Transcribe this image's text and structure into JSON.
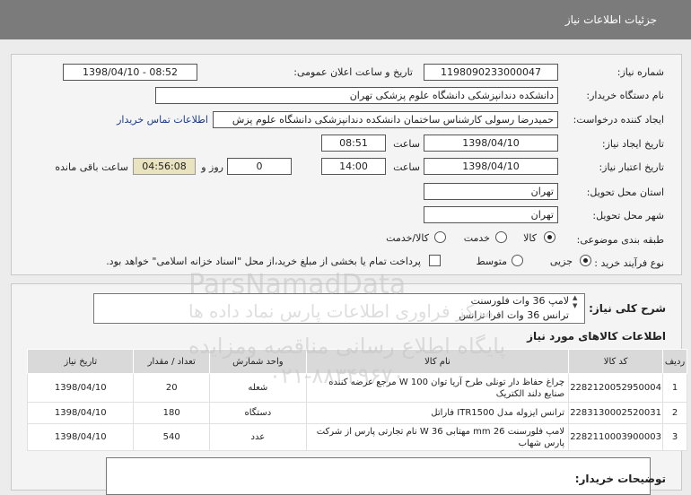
{
  "header": {
    "title": "جزئیات اطلاعات نیاز"
  },
  "form": {
    "need_number_label": "شماره نیاز:",
    "need_number": "1198090233000047",
    "announce_label": "تاریخ و ساعت اعلان عمومی:",
    "announce_value": "1398/04/10 - 08:52",
    "buyer_label": "نام دستگاه خریدار:",
    "buyer_value": "دانشکده دندانپزشکی دانشگاه علوم پزشکی تهران",
    "creator_label": "ایجاد کننده درخواست:",
    "creator_value": "حمیدرضا رسولی کارشناس ساختمان دانشکده دندانپزشکی دانشگاه علوم پزش",
    "contact_link": "اطلاعات تماس خریدار",
    "created_label": "تاریخ ایجاد نیاز:",
    "created_date": "1398/04/10",
    "created_time_label": "ساعت",
    "created_time": "08:51",
    "valid_label": "تاریخ اعتبار نیاز:",
    "valid_date": "1398/04/10",
    "valid_time_label": "ساعت",
    "valid_time": "14:00",
    "days_value": "0",
    "days_label": "روز و",
    "remain_value": "04:56:08",
    "remain_label": "ساعت باقی مانده",
    "province_label": "استان محل تحویل:",
    "province_value": "تهران",
    "city_label": "شهر محل تحویل:",
    "city_value": "تهران",
    "category_label": "طبقه بندی موضوعی:",
    "cat_goods": "کالا",
    "cat_service": "خدمت",
    "cat_both": "کالا/خدمت",
    "process_label": "نوع فرآیند خرید :",
    "proc_small": "جزیی",
    "proc_medium": "متوسط",
    "payment_note": "پرداخت تمام یا بخشی از مبلغ خرید،از محل \"اسناد خزانه اسلامی\" خواهد بود."
  },
  "summary": {
    "label": "شرح کلی نیاز:",
    "line1": "لامپ 36 وات فلورسنت",
    "line2": "ترانس 36 وات افرا ترانس"
  },
  "items": {
    "section_title": "اطلاعات کالاهای مورد نیاز",
    "headers": [
      "ردیف",
      "کد کالا",
      "نام کالا",
      "واحد شمارش",
      "تعداد / مقدار",
      "تاریخ نیاز"
    ],
    "rows": [
      {
        "n": "1",
        "code": "2282120052950004",
        "name": "چراغ حفاظ دار تونلی طرح آریا توان W 100 مرجع عرضه کننده صنایع دلند الکتریک",
        "unit": "شعله",
        "qty": "20",
        "date": "1398/04/10"
      },
      {
        "n": "2",
        "code": "2283130002520031",
        "name": "ترانس ایزوله مدل ITR1500 فاراتل",
        "unit": "دستگاه",
        "qty": "180",
        "date": "1398/04/10"
      },
      {
        "n": "3",
        "code": "2282110003900003",
        "name": "لامپ فلورسنت 26 mm مهتابی W 36 نام تجارتی پارس از شرکت پارس شهاب",
        "unit": "عدد",
        "qty": "540",
        "date": "1398/04/10"
      }
    ]
  },
  "notes": {
    "label": "توضیحات خریدار:"
  },
  "watermark": {
    "brand": "ParsNamadData",
    "tagline": "پایگاه اطلاع رسانی مناقصه ومزایده",
    "tagline2": "مرکز فراوری اطلاعات پارس نماد داده ها",
    "phone": "۰۲۱-۸۸۳۴۹۶۷۰"
  }
}
